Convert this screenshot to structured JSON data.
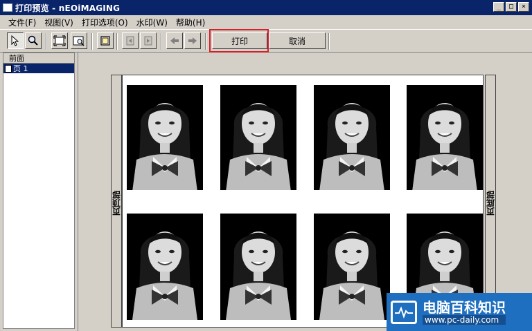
{
  "window": {
    "title": "打印预览 - nEOiMAGING",
    "controls": [
      "_",
      "□",
      "×"
    ]
  },
  "menu": [
    "文件(F)",
    "视图(V)",
    "打印选项(O)",
    "水印(W)",
    "帮助(H)"
  ],
  "toolbar": {
    "icons": [
      "pointer-icon",
      "zoom-icon",
      "fit-page-icon",
      "zoom-page-icon",
      "single-page-icon",
      "prev-doc-icon",
      "next-doc-icon",
      "arrow-left-icon",
      "arrow-right-icon"
    ],
    "print_label": "打印",
    "cancel_label": "取消"
  },
  "left_panel": {
    "header": "前面",
    "items": [
      "页 1"
    ]
  },
  "preview": {
    "header_label": "页顶部",
    "footer_label": "页底部"
  },
  "watermark": {
    "title": "电脑百科知识",
    "url": "www.pc-daily.com"
  },
  "colors": {
    "title_bar": "#0a246a",
    "highlight": "#d2202a",
    "watermark_bg": "#1f6fc1"
  }
}
